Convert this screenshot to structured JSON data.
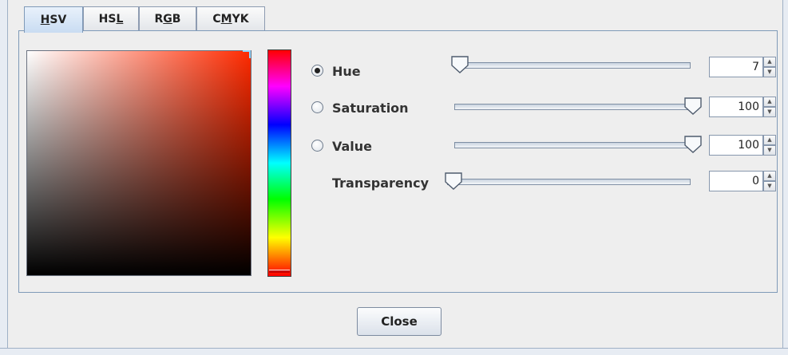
{
  "tabs": [
    {
      "pre": "",
      "mnemonic": "H",
      "post": "SV"
    },
    {
      "pre": "HS",
      "mnemonic": "L",
      "post": ""
    },
    {
      "pre": "R",
      "mnemonic": "G",
      "post": "B"
    },
    {
      "pre": "C",
      "mnemonic": "M",
      "post": "YK"
    }
  ],
  "active_tab": "HSV",
  "current_color": "#ff2a00",
  "rows": [
    {
      "label": "Hue",
      "value": "7",
      "radio": true,
      "checked": true,
      "slider_fraction": 0.02
    },
    {
      "label": "Saturation",
      "value": "100",
      "radio": true,
      "checked": false,
      "slider_fraction": 1.0
    },
    {
      "label": "Value",
      "value": "100",
      "radio": true,
      "checked": false,
      "slider_fraction": 1.0
    },
    {
      "label": "Transparency",
      "value": "0",
      "radio": false,
      "checked": false,
      "slider_fraction": 0.0
    }
  ],
  "close_label": "Close"
}
